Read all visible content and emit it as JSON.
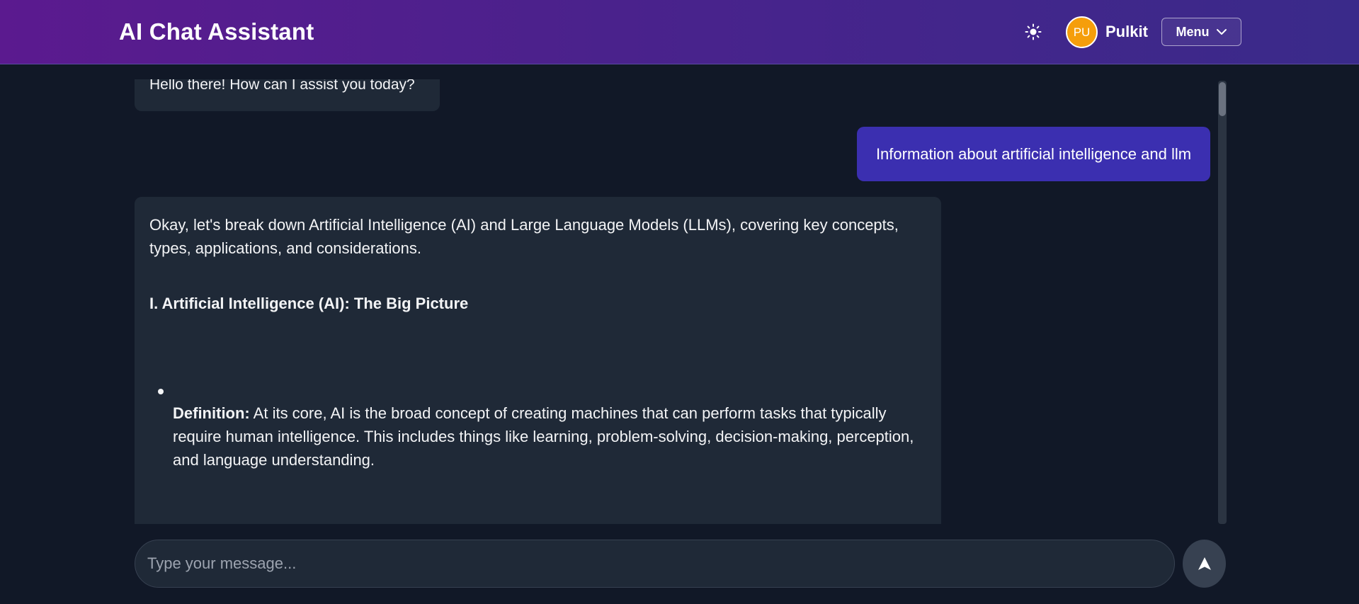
{
  "header": {
    "title": "AI Chat Assistant",
    "theme_icon": "sun-icon",
    "user": {
      "initials": "PU",
      "name": "Pulkit",
      "avatar_color": "#f59e0b"
    },
    "menu_label": "Menu",
    "menu_icon": "chevron-down-icon"
  },
  "chat": {
    "messages": [
      {
        "role": "assistant",
        "text": "Hello there! How can I assist you today?"
      },
      {
        "role": "user",
        "text": "Information about artificial intelligence and llm"
      },
      {
        "role": "assistant",
        "intro": "Okay, let's break down Artificial Intelligence (AI) and Large Language Models (LLMs), covering key concepts, types, applications, and considerations.",
        "heading": "I. Artificial Intelligence (AI): The Big Picture",
        "bullets": [
          {
            "label": "Definition:",
            "text": " At its core, AI is the broad concept of creating machines that can perform tasks that typically require human intelligence. This includes things like learning, problem-solving, decision-making, perception, and language understanding."
          }
        ]
      }
    ]
  },
  "composer": {
    "placeholder": "Type your message...",
    "value": "",
    "send_icon": "send-arrow-icon"
  },
  "colors": {
    "header_gradient_start": "#5b1a8f",
    "header_gradient_end": "#3a2a8a",
    "background": "#111827",
    "assistant_bubble": "#1f2937",
    "user_bubble": "#3b2fb0"
  }
}
